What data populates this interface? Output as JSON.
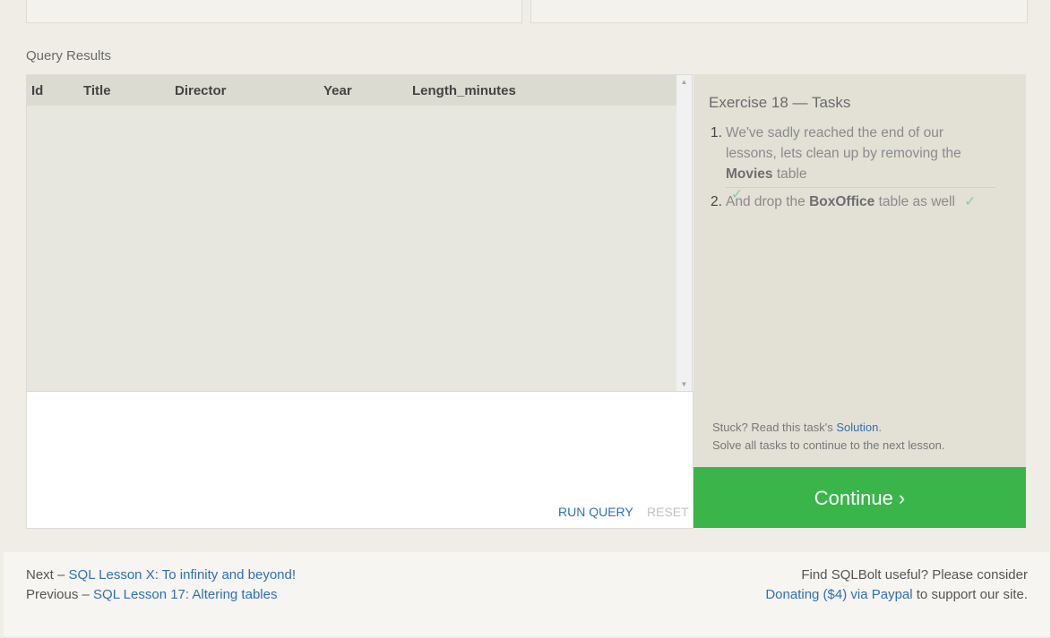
{
  "results": {
    "label": "Query Results",
    "columns": [
      "Id",
      "Title",
      "Director",
      "Year",
      "Length_minutes"
    ]
  },
  "editor": {
    "run_label": "RUN QUERY",
    "reset_label": "RESET"
  },
  "tasks": {
    "title": "Exercise 18 — Tasks",
    "items": [
      {
        "num": "1.",
        "pre": "We've sadly reached the end of our lessons, lets clean up by removing the ",
        "bold": "Movies",
        "post": " table",
        "check": "✓"
      },
      {
        "num": "2.",
        "pre": "And drop the ",
        "bold": "BoxOffice",
        "post": " table as well",
        "check": "✓"
      }
    ],
    "stuck_pre": "Stuck? Read this task's ",
    "solution_link": "Solution",
    "stuck_post": ".",
    "solve_text": "Solve all tasks to continue to the next lesson."
  },
  "continue_label": "Continue ›",
  "footer": {
    "next_prefix": "Next – ",
    "next_link": "SQL Lesson X: To infinity and beyond!",
    "prev_prefix": "Previous – ",
    "prev_link": "SQL Lesson 17: Altering tables",
    "support_line": "Find SQLBolt useful? Please consider",
    "donate_link": "Donating ($4) via Paypal",
    "donate_suffix": " to support our site."
  },
  "colors": {
    "continue": "#3ab54a",
    "link": "#2f6fb5",
    "check": "#8fc79b"
  }
}
